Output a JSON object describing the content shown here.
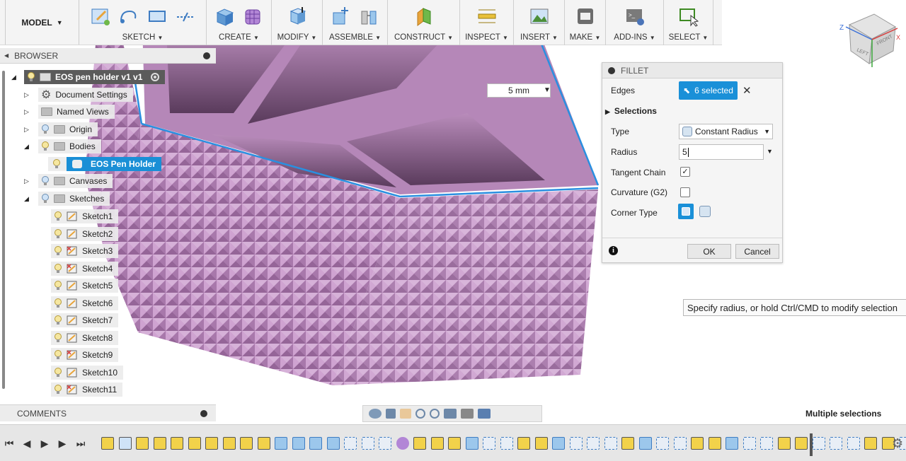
{
  "workspace": {
    "label": "MODEL"
  },
  "toolbar": {
    "groups": [
      {
        "label": "SKETCH"
      },
      {
        "label": "CREATE"
      },
      {
        "label": "MODIFY"
      },
      {
        "label": "ASSEMBLE"
      },
      {
        "label": "CONSTRUCT"
      },
      {
        "label": "INSPECT"
      },
      {
        "label": "INSERT"
      },
      {
        "label": "MAKE"
      },
      {
        "label": "ADD-INS"
      },
      {
        "label": "SELECT"
      }
    ]
  },
  "browser": {
    "title": "BROWSER",
    "root": "EOS pen holder v1 v1",
    "items": [
      {
        "label": "Document Settings"
      },
      {
        "label": "Named Views"
      },
      {
        "label": "Origin"
      },
      {
        "label": "Bodies"
      },
      {
        "label": "EOS Pen Holder"
      },
      {
        "label": "Canvases"
      },
      {
        "label": "Sketches"
      }
    ],
    "sketches": [
      "Sketch1",
      "Sketch2",
      "Sketch3",
      "Sketch4",
      "Sketch5",
      "Sketch6",
      "Sketch7",
      "Sketch8",
      "Sketch9",
      "Sketch10",
      "Sketch11"
    ]
  },
  "viewcube": {
    "front": "FRONT",
    "left": "LEFT",
    "axis_z": "Z",
    "axis_x": "X"
  },
  "radius_input": {
    "value": "5 mm"
  },
  "fillet": {
    "title": "FILLET",
    "edges_label": "Edges",
    "edges_value": "6 selected",
    "selections_label": "Selections",
    "type_label": "Type",
    "type_value": "Constant Radius",
    "radius_label": "Radius",
    "radius_value": "5",
    "tangent_label": "Tangent Chain",
    "curvature_label": "Curvature (G2)",
    "corner_label": "Corner Type",
    "ok": "OK",
    "cancel": "Cancel",
    "tangent_checked": true,
    "curvature_checked": false
  },
  "tooltip": {
    "text": "Specify radius, or hold Ctrl/CMD to modify selection"
  },
  "comments": {
    "title": "COMMENTS"
  },
  "status": {
    "text": "Multiple selections"
  },
  "colors": {
    "body": "#c796c9",
    "accent": "#1a90d8"
  }
}
